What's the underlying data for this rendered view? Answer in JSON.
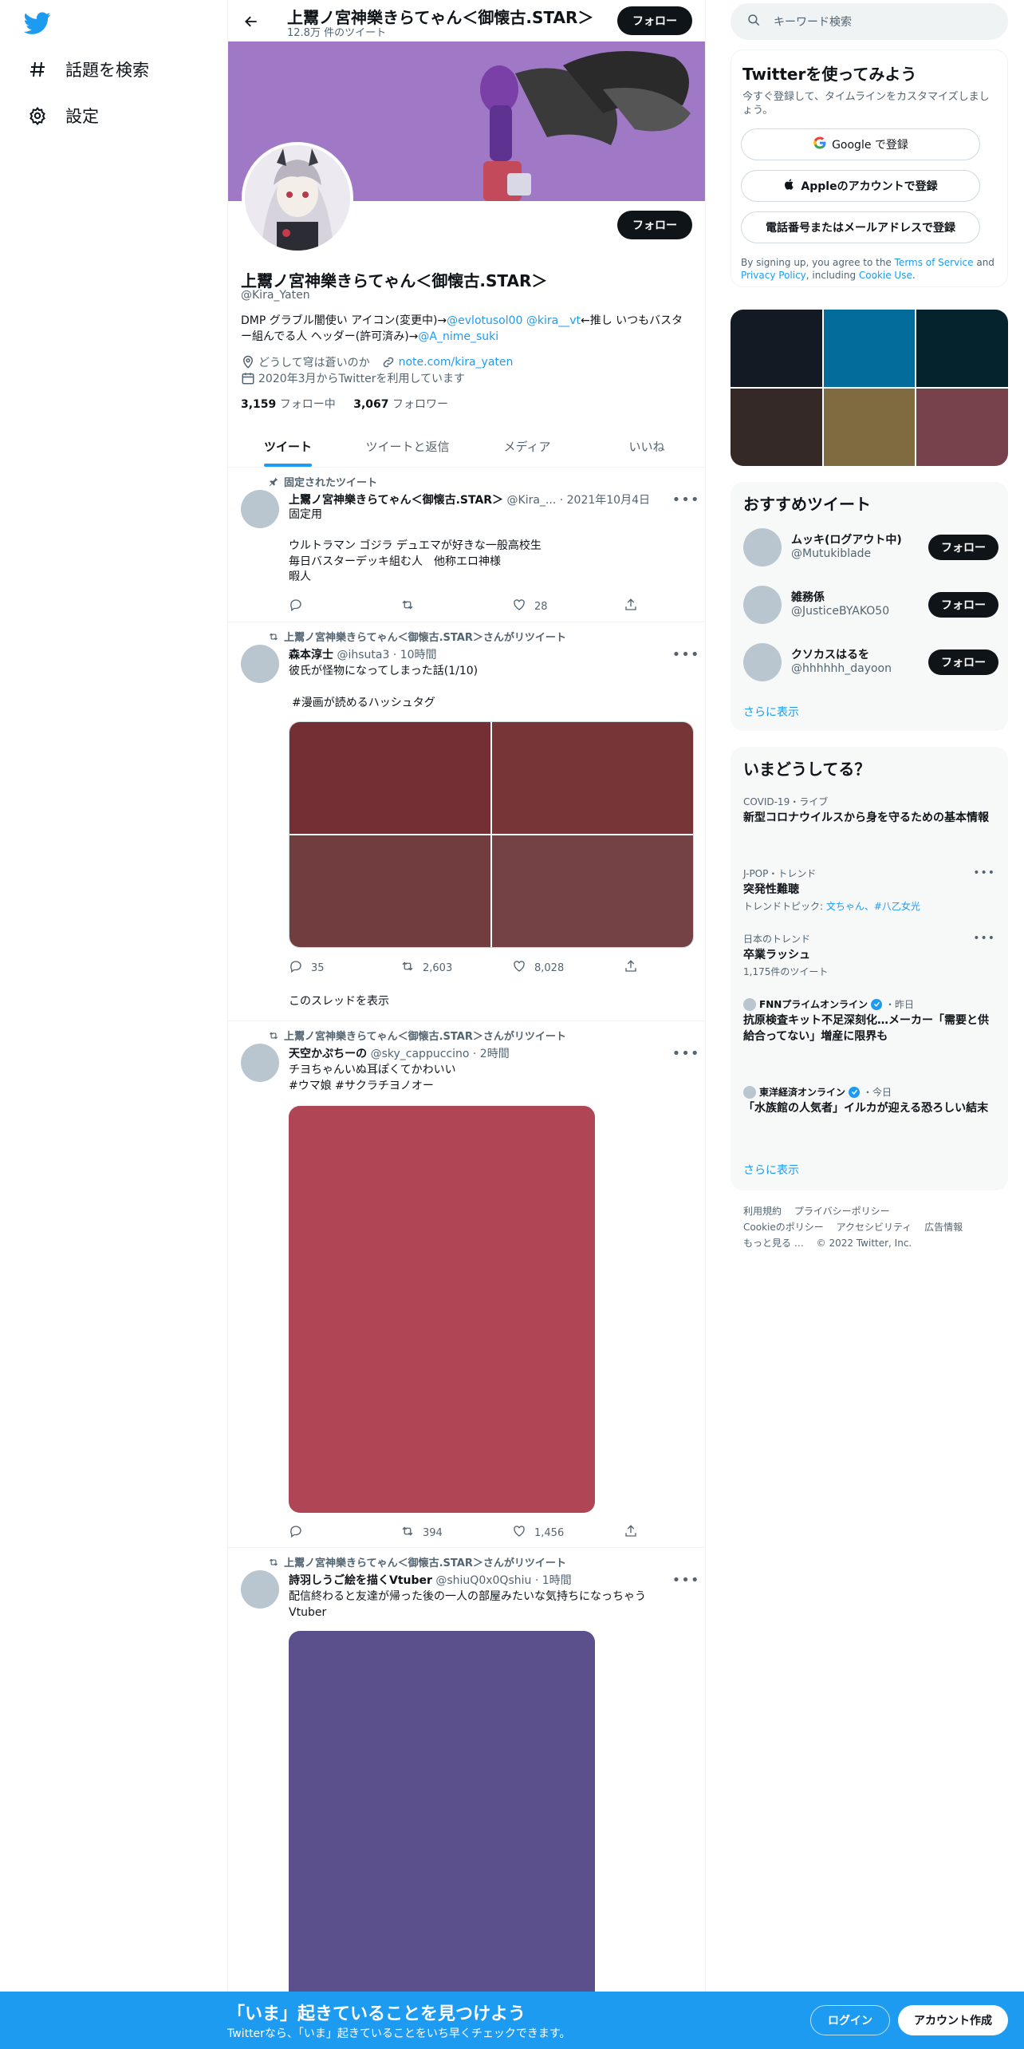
{
  "colors": {
    "accent": "#1d9bf0",
    "text": "#0f1419",
    "muted": "#536471",
    "banner": "#a079c6"
  },
  "nav": {
    "items": [
      {
        "label": "話題を検索",
        "icon": "hashtag-icon"
      },
      {
        "label": "設定",
        "icon": "gear-icon"
      }
    ]
  },
  "header": {
    "title": "上鬻ノ宮神樂きらてゃん＜御懐古.STAR＞",
    "tweet_count": "12.8万 件のツイート",
    "follow_label": "フォロー"
  },
  "profile": {
    "name": "上鬻ノ宮神樂きらてゃん＜御懐古.STAR＞",
    "handle": "@Kira_Yaten",
    "follow_label": "フォロー",
    "bio_part1": "DMP グラブル闇使い アイコン(変更中)→",
    "bio_link1": "@evlotusol00",
    "bio_link2": "@kira__vt",
    "bio_part2": "←推し いつもバスター組んでる人 ヘッダー(許可済み)→",
    "bio_link3": "@A_nime_suki",
    "location": "どうして穹は蒼いのか",
    "website": "note.com/kira_yaten",
    "joined": "2020年3月からTwitterを利用しています",
    "following_count": "3,159",
    "following_label": "フォロー中",
    "followers_count": "3,067",
    "followers_label": "フォロワー"
  },
  "tabs": [
    "ツイート",
    "ツイートと返信",
    "メディア",
    "いいね"
  ],
  "tweets": [
    {
      "context": "固定されたツイート",
      "name": "上鬻ノ宮神樂きらてゃん＜御懐古.STAR＞",
      "handle": "@Kira_...",
      "time": "· 2021年10月4日",
      "text": "固定用\n\nウルトラマン ゴジラ デュエマが好きな一般高校生\n毎日バスターデッキ組む人　他称エロ神様\n暇人",
      "replies": "",
      "retweets": "",
      "likes": "28"
    },
    {
      "context": "上鬻ノ宮神樂きらてゃん＜御懐古.STAR＞さんがリツイート",
      "name": "森本淳士",
      "handle": "@ihsuta3",
      "time": "· 10時間",
      "text": "彼氏が怪物になってしまった話(1/10)",
      "hashtag": "#漫画が読めるハッシュタグ",
      "media_colors": [
        "#732f34",
        "#773537",
        "#713d3f",
        "#744145"
      ],
      "replies": "35",
      "retweets": "2,603",
      "likes": "8,028",
      "thread_label": "このスレッドを表示"
    },
    {
      "context": "上鬻ノ宮神樂きらてゃん＜御懐古.STAR＞さんがリツイート",
      "name": "天空かぷちーの",
      "handle": "@sky_cappuccino",
      "time": "· 2時間",
      "text": "チヨちゃんいぬ耳ぽくてかわいい",
      "hashtags": "#ウマ娘 #サクラチヨノオー",
      "media_color": "#b04555",
      "replies": "",
      "retweets": "394",
      "likes": "1,456"
    },
    {
      "context": "上鬻ノ宮神樂きらてゃん＜御懐古.STAR＞さんがリツイート",
      "name": "詩羽しうご絵を描くVtuber",
      "handle": "@shiuQ0x0Qshiu",
      "time": "· 1時間",
      "text": "配信終わると友達が帰った後の一人の部屋みたいな気持ちになっちゃう\nVtuber",
      "media_color": "#5b4f8c"
    }
  ],
  "search": {
    "placeholder": "キーワード検索"
  },
  "signup": {
    "title": "Twitterを使ってみよう",
    "desc": "今すぐ登録して、タイムラインをカスタマイズしましょう。",
    "google": "Google で登録",
    "apple": "Appleのアカウントで登録",
    "phone": "電話番号またはメールアドレスで登録",
    "terms_prefix": "By signing up, you agree to the ",
    "terms_tos": "Terms of Service",
    "terms_and": " and ",
    "terms_privacy": "Privacy Policy",
    "terms_incl": ", including ",
    "terms_cookie": "Cookie Use",
    "terms_end": "."
  },
  "photo_grid_colors": [
    "#141a24",
    "#046c9a",
    "#04232c",
    "#342927",
    "#7f6b3f",
    "#77424b"
  ],
  "recommend": {
    "title": "おすすめツイート",
    "accounts": [
      {
        "name": "ムッキ(ログアウト中)",
        "handle": "@Mutukiblade"
      },
      {
        "name": "雑務係",
        "handle": "@JusticeBYAKO50"
      },
      {
        "name": "クソカスはるを",
        "handle": "@hhhhhh_dayoon"
      }
    ],
    "follow_label": "フォロー",
    "more": "さらに表示"
  },
  "trends": {
    "title": "いまどうしてる？",
    "items": [
      {
        "meta": "COVID-19・ライブ",
        "title": "新型コロナウイルスから身を守るための基本情報"
      },
      {
        "meta": "J-POP・トレンド",
        "title": "突発性難聴",
        "sub_prefix": "トレンドトピック: ",
        "sub_links": "文ちゃん、#八乙女光"
      },
      {
        "meta": "日本のトレンド",
        "title": "卒業ラッシュ",
        "sub": "1,175件のツイート"
      },
      {
        "source": "FNNプライムオンライン",
        "meta": "・昨日",
        "title": "抗原検査キット不足深刻化…メーカー「需要と供給合ってない」増産に限界も"
      },
      {
        "source": "東洋経済オンライン",
        "meta": "・今日",
        "title": "「水族館の人気者」イルカが迎える恐ろしい結末"
      }
    ],
    "more": "さらに表示"
  },
  "footer": {
    "links": [
      "利用規約",
      "プライバシーポリシー",
      "Cookieのポリシー",
      "アクセシビリティ",
      "広告情報",
      "もっと見る …"
    ],
    "copyright": "© 2022 Twitter, Inc."
  },
  "bottom_bar": {
    "title": "「いま」起きていることを見つけよう",
    "sub": "Twitterなら、「いま」起きていることをいち早くチェックできます。",
    "login": "ログイン",
    "signup": "アカウント作成"
  }
}
